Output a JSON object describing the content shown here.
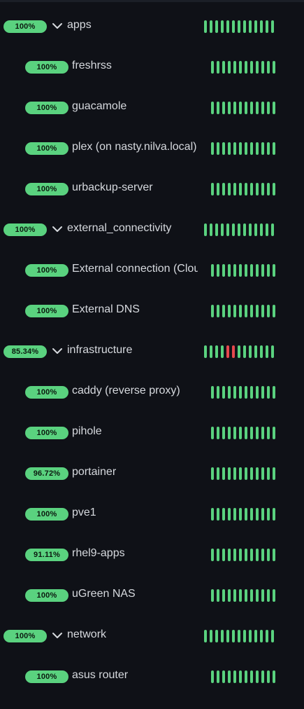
{
  "colors": {
    "up": "#5ad27f",
    "down": "#e5484d",
    "background": "#0f1117",
    "text": "#d6d9de"
  },
  "groups": [
    {
      "name": "apps",
      "uptime": "100%",
      "icon": "chevron-down-icon",
      "bars": "ggggggggggggg",
      "monitors": [
        {
          "name": "freshrss",
          "uptime": "100%",
          "bars": "ggggggggggggg"
        },
        {
          "name": "guacamole",
          "uptime": "100%",
          "bars": "ggggggggggggg"
        },
        {
          "name": "plex (on nasty.nilva.local)",
          "uptime": "100%",
          "bars": "ggggggggggggg"
        },
        {
          "name": "urbackup-server",
          "uptime": "100%",
          "bars": "ggggggggggggg"
        }
      ]
    },
    {
      "name": "external_connectivity",
      "uptime": "100%",
      "icon": "chevron-down-icon",
      "bars": "ggggggggggggg",
      "monitors": [
        {
          "name": "External connection (Cloudflare)",
          "uptime": "100%",
          "bars": "ggggggggggggg"
        },
        {
          "name": "External DNS",
          "uptime": "100%",
          "bars": "ggggggggggggg"
        }
      ]
    },
    {
      "name": "infrastructure",
      "uptime": "85.34%",
      "icon": "chevron-down-icon",
      "bars": "ggggrrggggggg",
      "monitors": [
        {
          "name": "caddy (reverse proxy)",
          "uptime": "100%",
          "bars": "ggggggggggggg"
        },
        {
          "name": "pihole",
          "uptime": "100%",
          "bars": "ggggggggggggg"
        },
        {
          "name": "portainer",
          "uptime": "96.72%",
          "bars": "ggggggggggggg"
        },
        {
          "name": "pve1",
          "uptime": "100%",
          "bars": "ggggggggggggg"
        },
        {
          "name": "rhel9-apps",
          "uptime": "91.11%",
          "bars": "ggggggggggggg"
        },
        {
          "name": "uGreen NAS",
          "uptime": "100%",
          "bars": "ggggggggggggg"
        }
      ]
    },
    {
      "name": "network",
      "uptime": "100%",
      "icon": "chevron-down-icon",
      "bars": "ggggggggggggg",
      "monitors": [
        {
          "name": "asus router",
          "uptime": "100%",
          "bars": "ggggggggggggg"
        }
      ]
    }
  ]
}
